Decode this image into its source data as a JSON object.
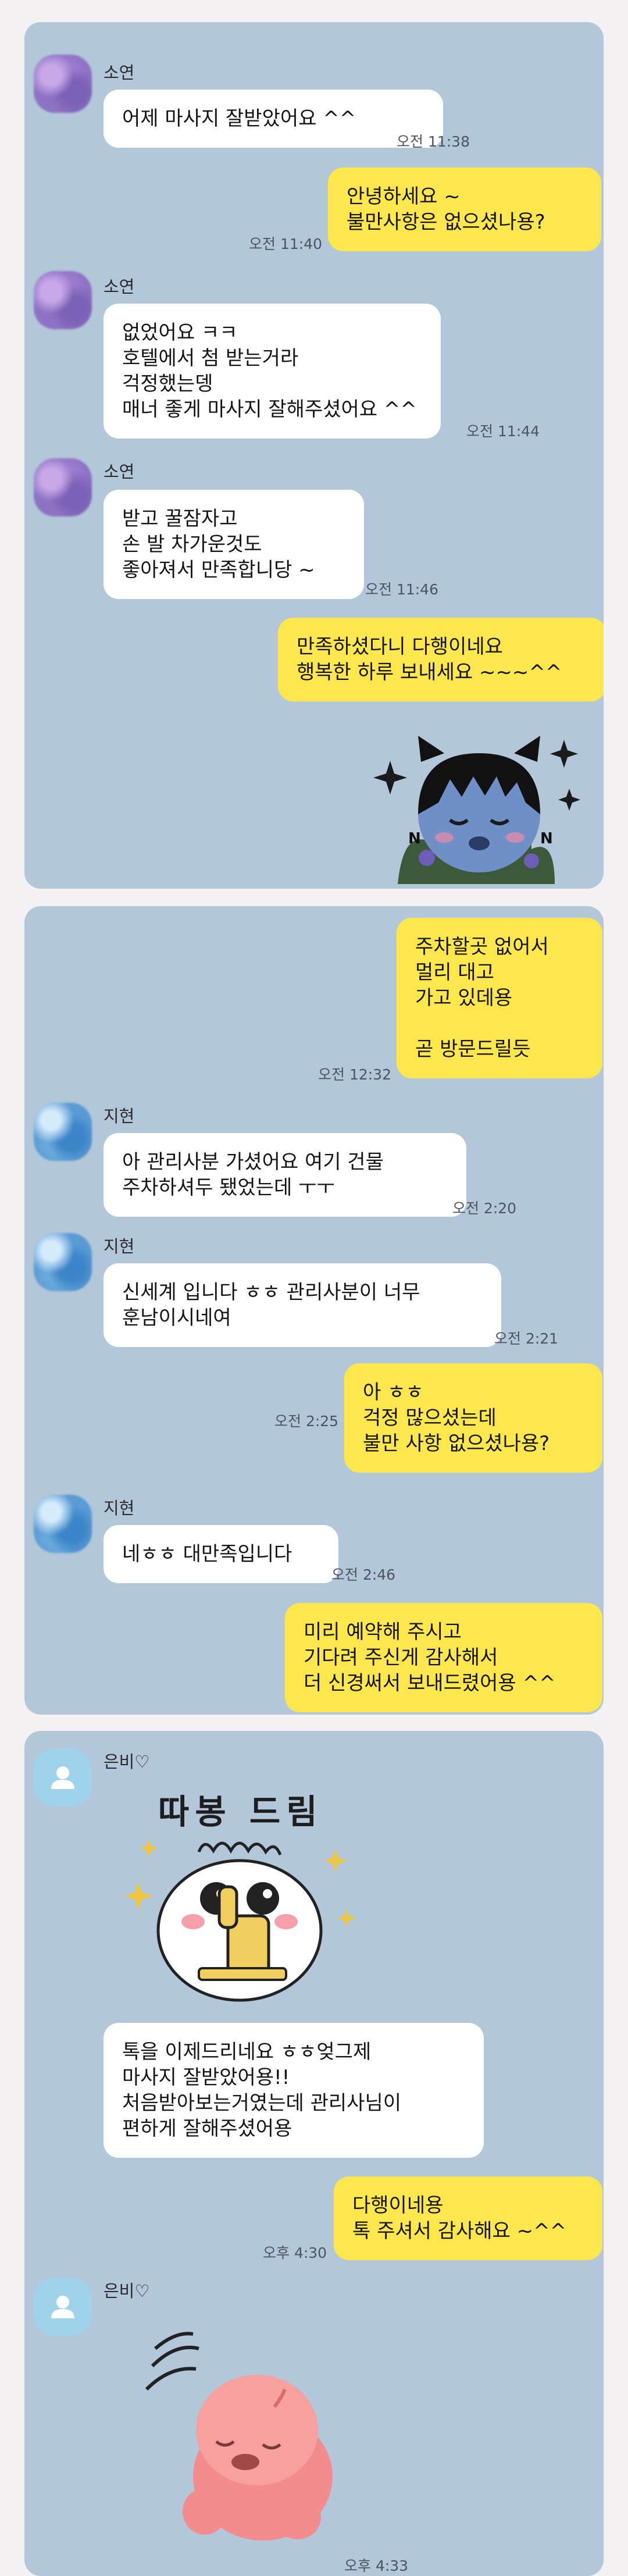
{
  "panel1": {
    "msg1": {
      "sender": "소연",
      "text": "어제 마사지 잘받았어요 ^^",
      "time": "오전 11:38"
    },
    "msg2": {
      "text": "안녕하세요 ~\n불만사항은 없으셨나용?",
      "time": "오전 11:40"
    },
    "msg3": {
      "sender": "소연",
      "text": "없었어요 ㅋㅋ\n호텔에서 첨 받는거라\n걱정했는뎅\n매너 좋게 마사지 잘해주셨어요 ^^",
      "time": "오전 11:44"
    },
    "msg4": {
      "sender": "소연",
      "text": "받고 꿀잠자고\n손 발 차가운것도\n좋아져서 만족합니당 ~",
      "time": "오전 11:46"
    },
    "msg5": {
      "text": "만족하셨다니 다행이네요\n행복한 하루 보내세요 ~~~^^"
    }
  },
  "panel2": {
    "msg1": {
      "text": "주차할곳 없어서\n멀리 대고\n가고 있데용\n\n곧 방문드릴듯",
      "time": "오전 12:32"
    },
    "msg2": {
      "sender": "지현",
      "text": "아 관리사분 가셨어요 여기 건물\n주차하셔두 됐었는데 ㅜㅜ",
      "time": "오전 2:20"
    },
    "msg3": {
      "sender": "지현",
      "text": "신세계 입니다 ㅎㅎ 관리사분이 너무\n훈남이시네여",
      "time": "오전 2:21"
    },
    "msg4": {
      "text": "아 ㅎㅎ\n걱정 많으셨는데\n불만 사항 없으셨나용?",
      "time": "오전 2:25"
    },
    "msg5": {
      "sender": "지현",
      "text": "네ㅎㅎ 대만족입니다",
      "time": "오전 2:46"
    },
    "msg6": {
      "text": "미리 예약해 주시고\n기다려 주신게 감사해서\n더 신경써서 보내드렸어용 ^^"
    }
  },
  "panel3": {
    "msg1": {
      "sender": "은비♡",
      "sticker_text": "따봉 드림"
    },
    "msg2": {
      "text": "톡을 이제드리네요 ㅎㅎ엊그제\n마사지 잘받았어용!!\n처음받아보는거였는데 관리사님이\n편하게 잘해주셨어용"
    },
    "msg3": {
      "text": "다행이네용\n톡 주셔서 감사해요 ~^^",
      "time": "오후 4:30"
    },
    "msg4": {
      "sender": "은비♡",
      "time": "오후 4:33"
    }
  },
  "colors": {
    "background": "#b2c7d9",
    "my_bubble": "#fee74c",
    "their_bubble": "#ffffff",
    "page": "#f3f1f2"
  }
}
